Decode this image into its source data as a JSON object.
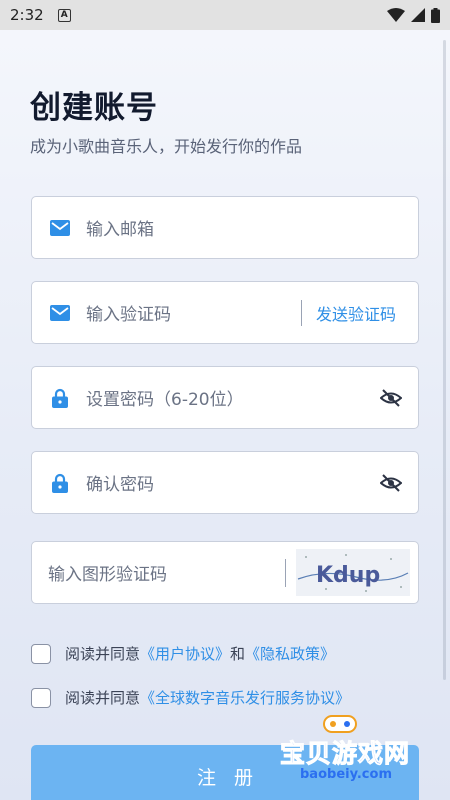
{
  "status_bar": {
    "time": "2:32",
    "badge": "A"
  },
  "header": {
    "title": "创建账号",
    "subtitle": "成为小歌曲音乐人，开始发行你的作品"
  },
  "form": {
    "email_placeholder": "输入邮箱",
    "code_placeholder": "输入验证码",
    "send_code_label": "发送验证码",
    "password_placeholder": "设置密码（6-20位）",
    "confirm_placeholder": "确认密码",
    "captcha_placeholder": "输入图形验证码",
    "captcha_text": "Kdup"
  },
  "agreements": {
    "prefix": "阅读并同意",
    "user_agreement": "《用户协议》",
    "and": "和",
    "privacy_policy": "《隐私政策》",
    "distribution_agreement": "《全球数字音乐发行服务协议》"
  },
  "register_label": "注册",
  "watermark": {
    "text": "宝贝游戏网",
    "domain": "baobeiy.com"
  },
  "colors": {
    "accent": "#2f8fe6",
    "button": "#6cb4f2",
    "icon": "#2f8fe6"
  }
}
